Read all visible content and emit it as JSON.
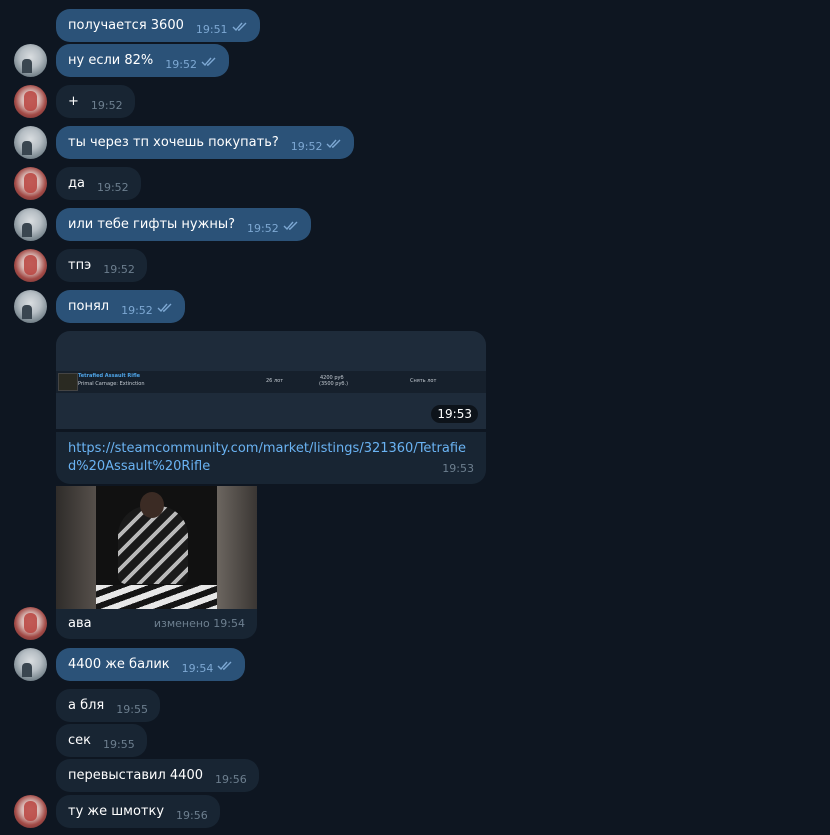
{
  "messages": [
    {
      "text": "получается 3600",
      "time": "19:51"
    },
    {
      "text": "ну если 82%",
      "time": "19:52"
    },
    {
      "text": "+",
      "time": "19:52"
    },
    {
      "text": "ты через тп хочешь покупать?",
      "time": "19:52"
    },
    {
      "text": "да",
      "time": "19:52"
    },
    {
      "text": "или тебе гифты нужны?",
      "time": "19:52"
    },
    {
      "text": "тпэ",
      "time": "19:52"
    },
    {
      "text": "понял",
      "time": "19:52"
    },
    {
      "text": "4400 же балик",
      "time": "19:54"
    },
    {
      "text": "а бля",
      "time": "19:55"
    },
    {
      "text": "сек",
      "time": "19:55"
    },
    {
      "text": "перевыставил 4400",
      "time": "19:56"
    },
    {
      "text": "ту же шмотку",
      "time": "19:56"
    }
  ],
  "screenshot_message": {
    "time": "19:53",
    "item_name": "Tetrafied Assault Rifle",
    "item_game": "Primal Carnage: Extinction",
    "count": "26 лот",
    "price": "4200 руб",
    "price_sub": "(3500 руб.)",
    "action": "Снять лот"
  },
  "link_message": {
    "url": "https://steamcommunity.com/market/listings/321360/Tetrafied%20Assault%20Rifle",
    "time": "19:53"
  },
  "photo_message": {
    "caption": "ава",
    "time": "изменено 19:54"
  },
  "colors": {
    "background": "#0e1621",
    "outgoing_bubble": "#2b5278",
    "incoming_bubble": "#182533",
    "link": "#6ab3f3",
    "out_time": "#7da8d3",
    "in_time": "#6d7f8f"
  }
}
